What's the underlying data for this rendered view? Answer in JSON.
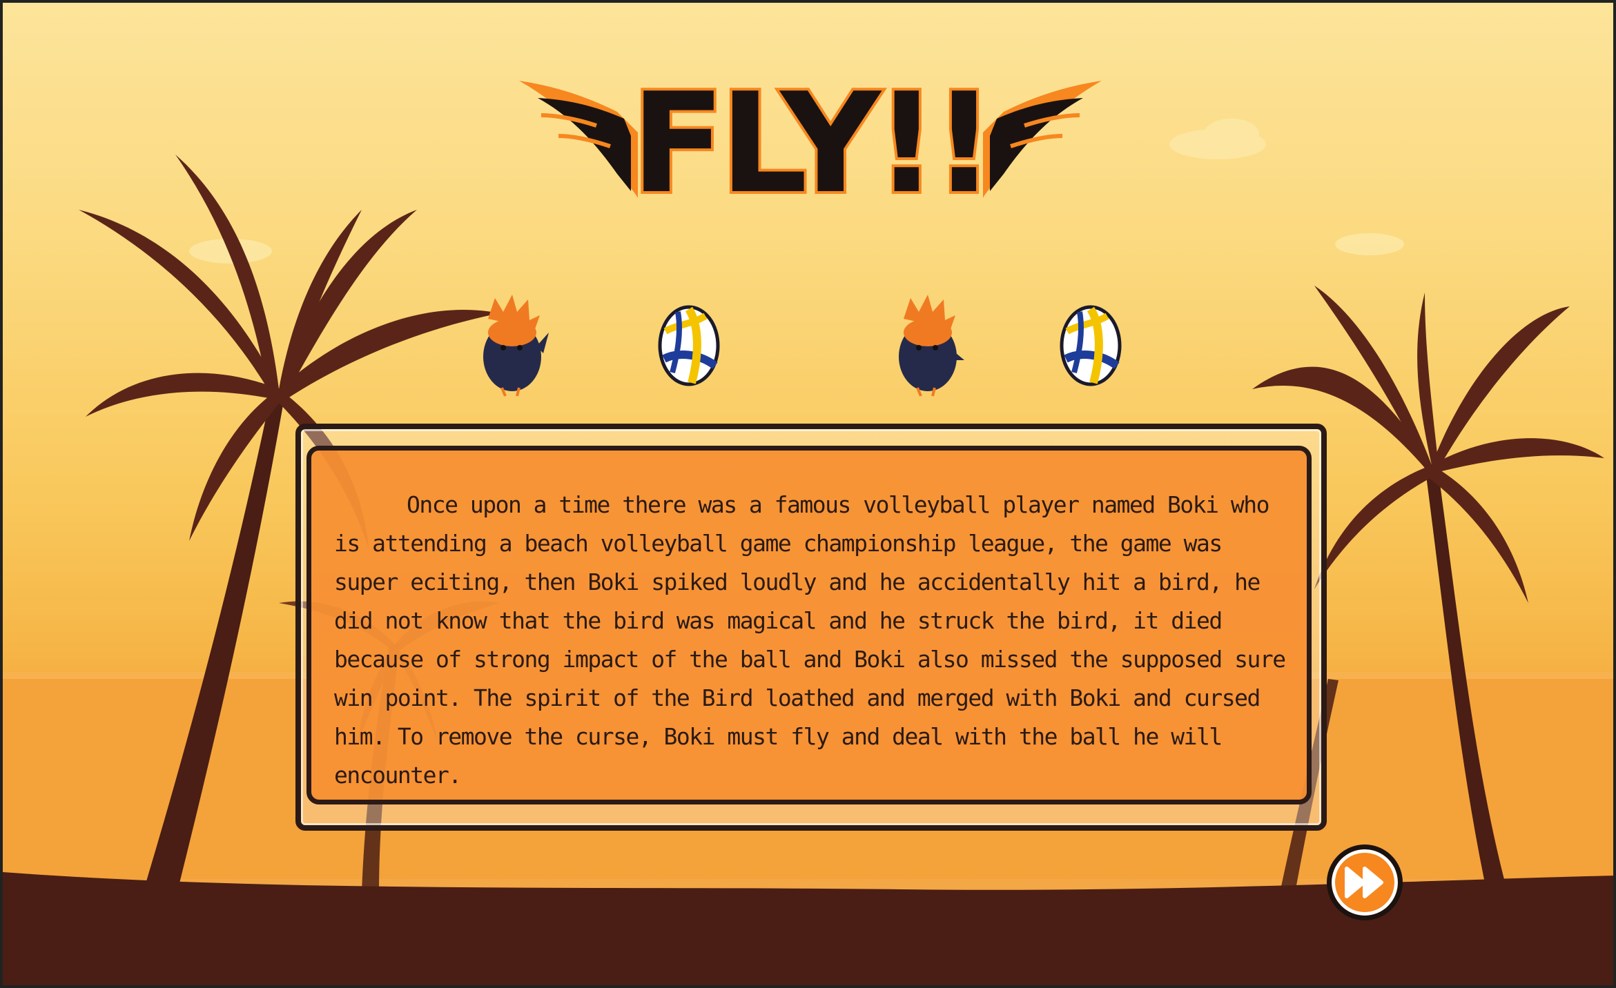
{
  "game": {
    "title_logo": "FLY!!",
    "story_text": "Once upon a time there was a famous volleyball player named Boki who is attending a beach volleyball game championship league, the game was super eciting, then Boki spiked loudly and he accidentally hit a bird, he did not know that the bird was magical and he struck the bird, it died because of strong impact of the ball and Boki also missed the supposed sure win point. The spirit of the Bird loathed and merged with Boki and cursed him. To remove the curse, Boki must fly and deal with the ball he will encounter.",
    "next_button_icon": "fast-forward-icon"
  },
  "colors": {
    "accent_orange": "#f7871f",
    "silhouette": "#4a1e14",
    "sky_top": "#fce49a"
  }
}
